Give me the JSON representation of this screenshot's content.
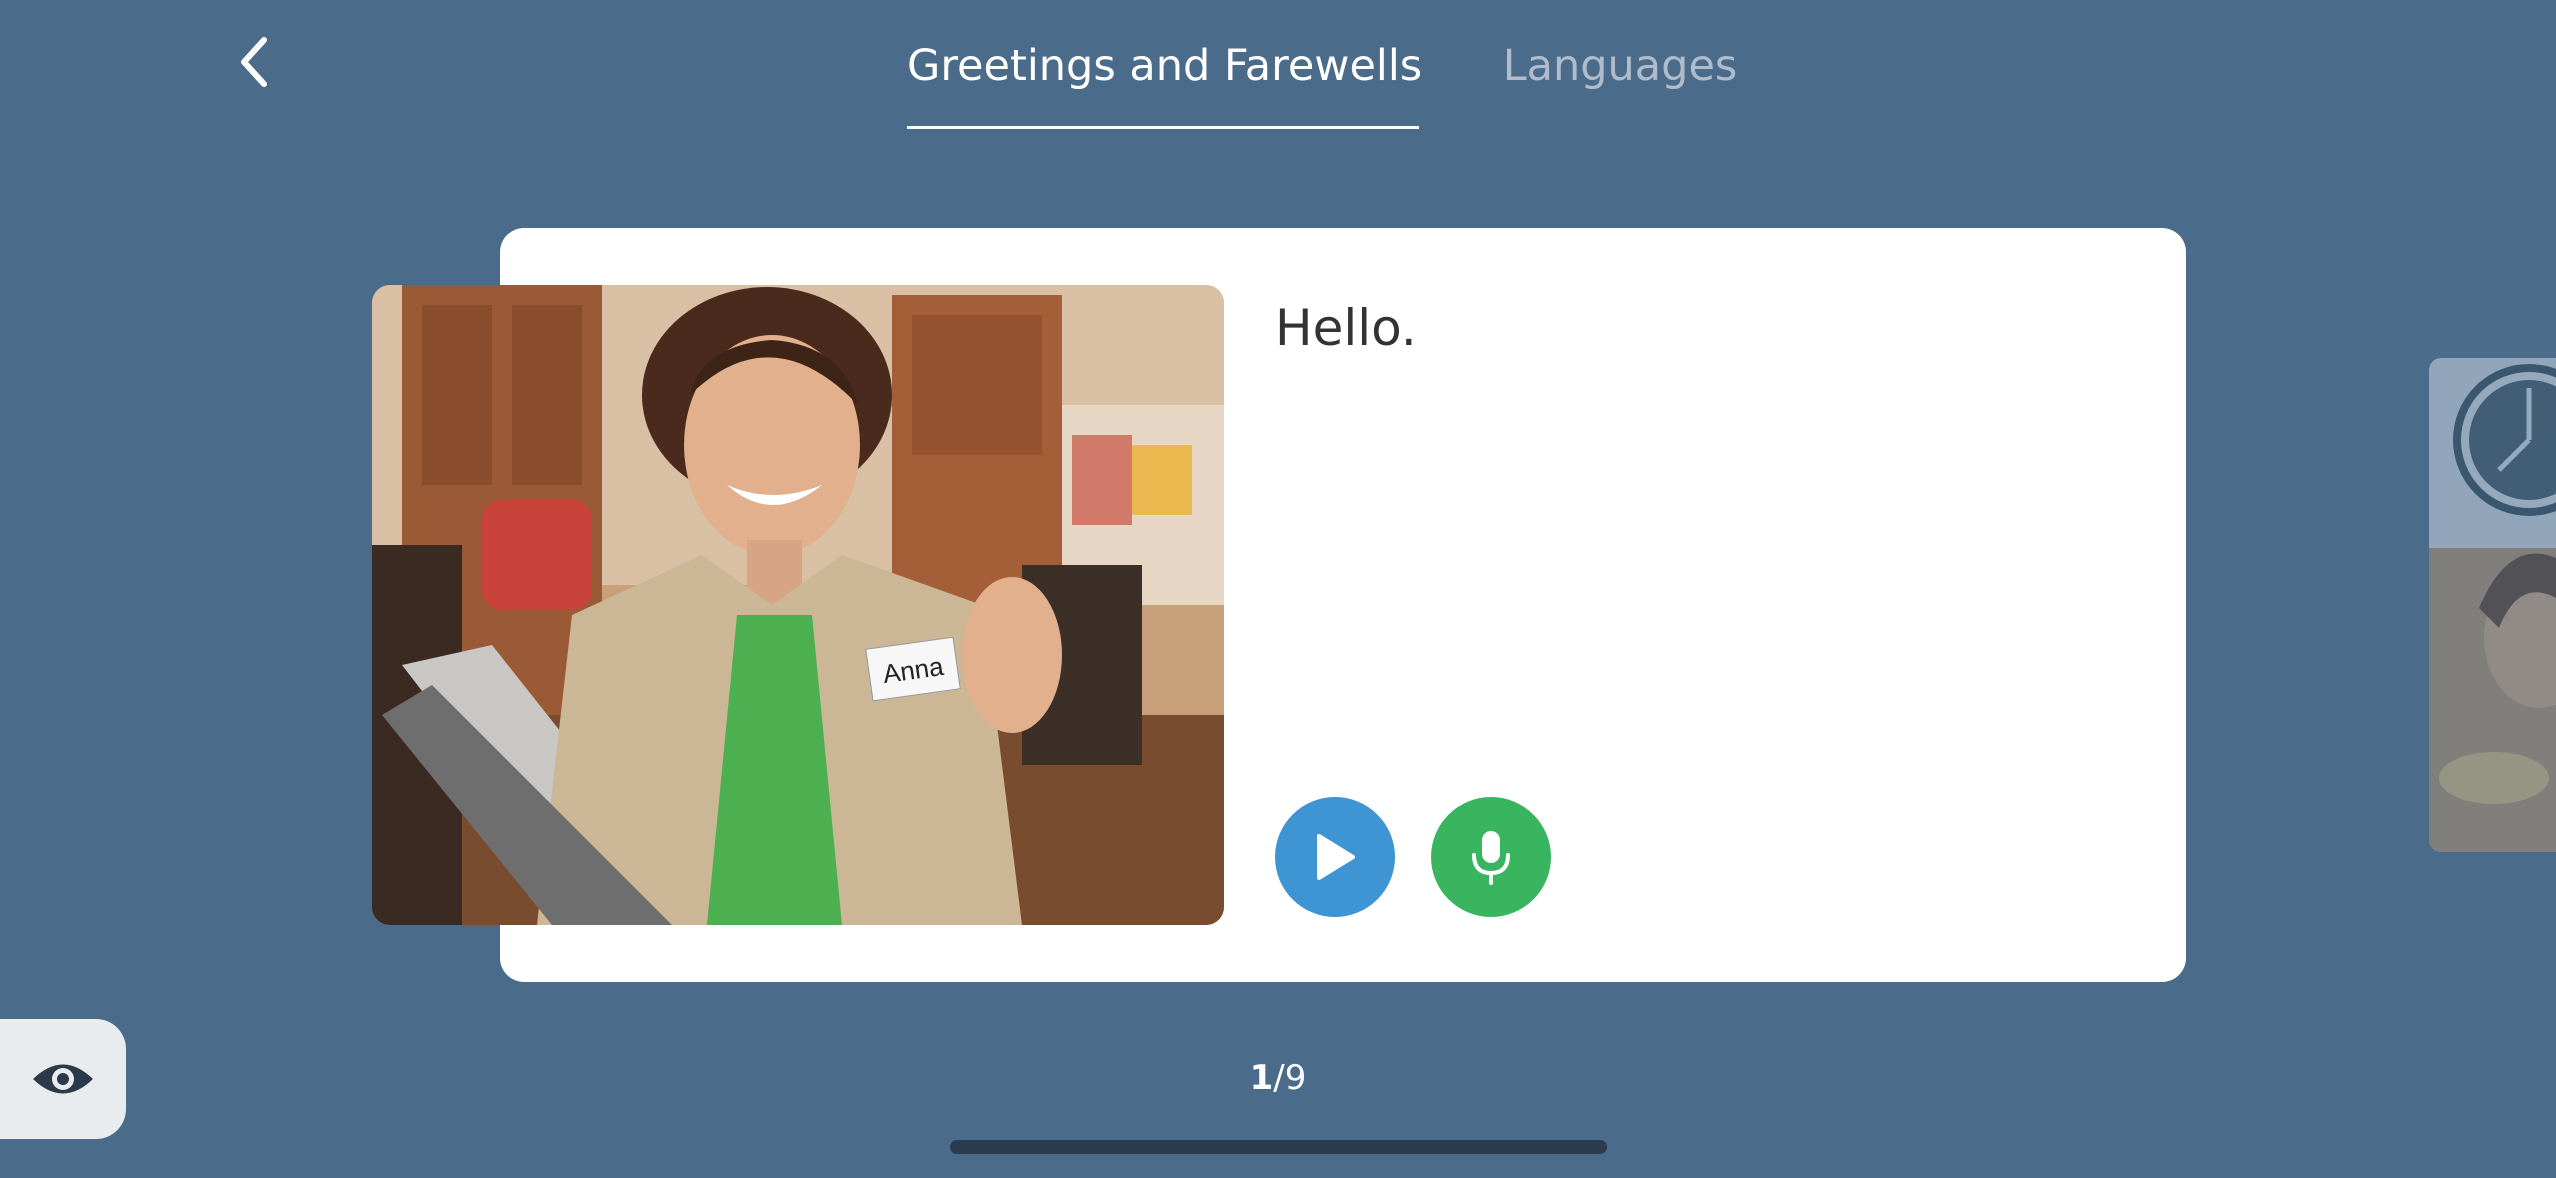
{
  "header": {
    "tabs": [
      {
        "label": "Greetings and Farewells",
        "active": true
      },
      {
        "label": "Languages",
        "active": false
      }
    ]
  },
  "card": {
    "phrase": "Hello.",
    "image_name_tag": "Anna",
    "icons": {
      "play": "play-icon",
      "record": "microphone-icon"
    }
  },
  "pagination": {
    "current": "1",
    "separator_total": "/9"
  },
  "colors": {
    "background": "#4a6b89",
    "play_button": "#3f94d3",
    "record_button": "#39b55f"
  }
}
